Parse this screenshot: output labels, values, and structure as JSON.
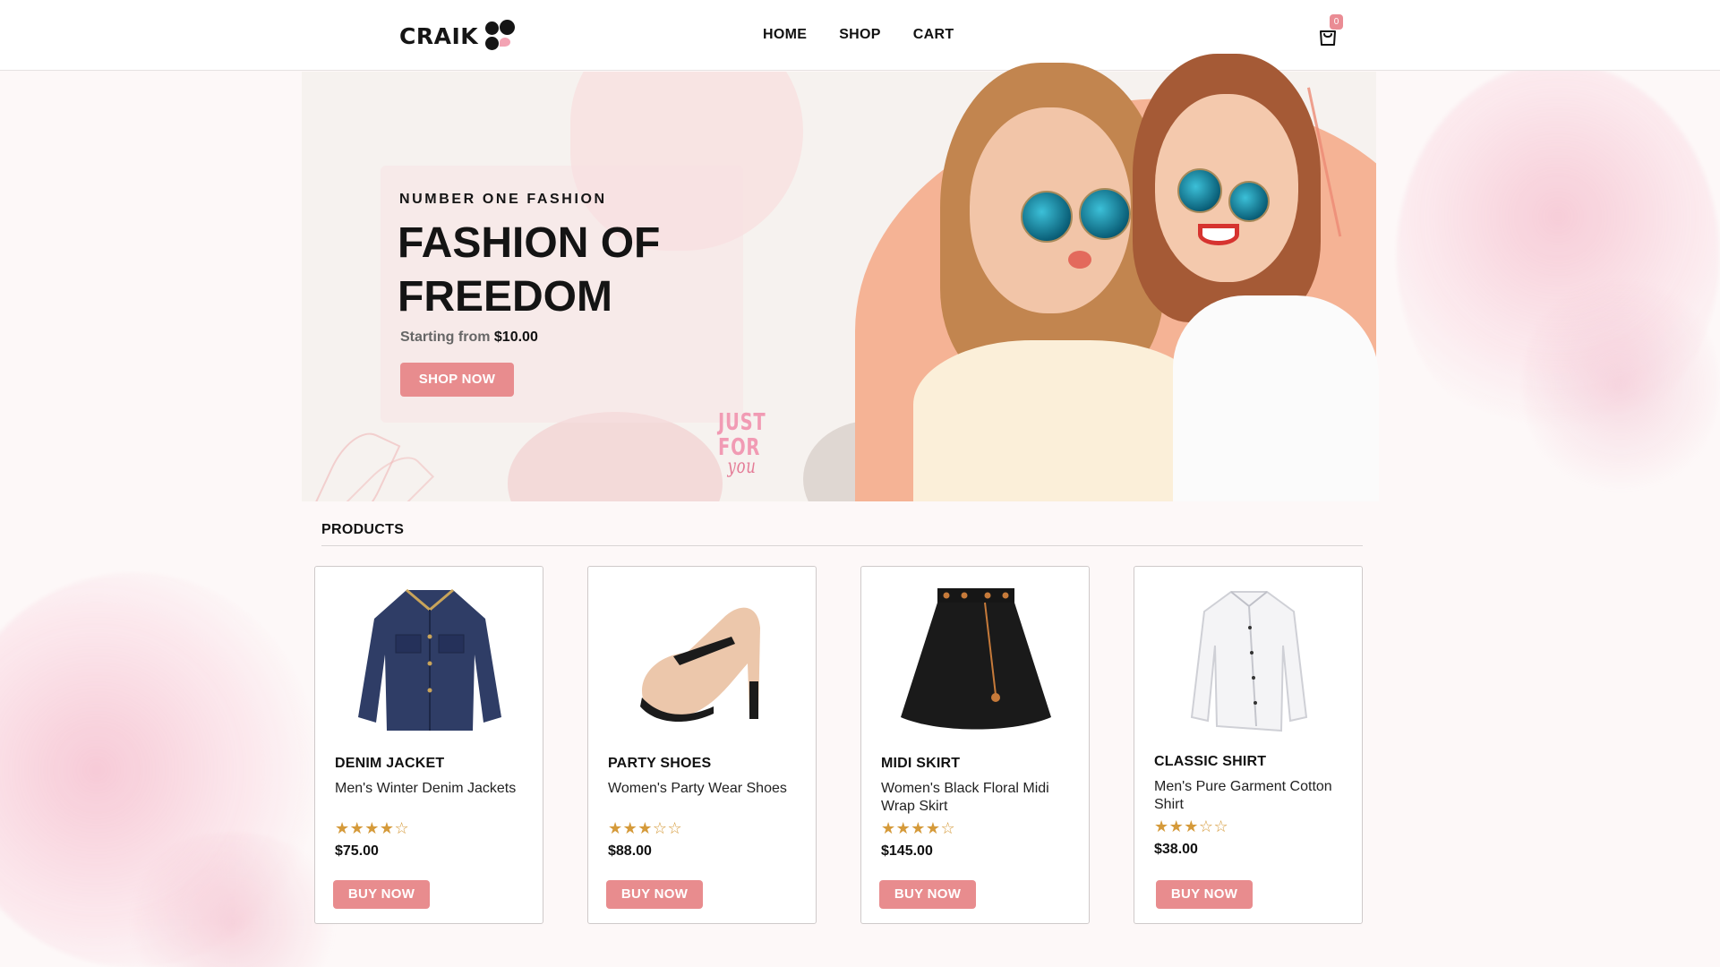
{
  "brand": {
    "name": "CRAIK"
  },
  "nav": {
    "items": [
      "HOME",
      "SHOP",
      "CART"
    ]
  },
  "cart": {
    "count": "0"
  },
  "hero": {
    "kicker": "NUMBER ONE FASHION",
    "title": "FASHION OF FREEDOM",
    "price_prefix": "Starting from",
    "price": "$10.00",
    "cta": "SHOP NOW",
    "badge_line1": "JUST",
    "badge_line2": "FOR",
    "badge_line3": "you"
  },
  "products_section": {
    "title": "PRODUCTS"
  },
  "products": [
    {
      "name": "DENIM JACKET",
      "description": "Men's Winter Denim Jackets",
      "rating": 4,
      "rating_stars": "★★★★☆",
      "price": "$75.00",
      "cta": "BUY NOW",
      "icon": "denim-jacket-image"
    },
    {
      "name": "PARTY SHOES",
      "description": "Women's Party Wear Shoes",
      "rating": 3,
      "rating_stars": "★★★☆☆",
      "price": "$88.00",
      "cta": "BUY NOW",
      "icon": "heel-shoe-image"
    },
    {
      "name": "MIDI SKIRT",
      "description": "Women's Black Floral Midi Wrap Skirt",
      "rating": 4,
      "rating_stars": "★★★★☆",
      "price": "$145.00",
      "cta": "BUY NOW",
      "icon": "black-skirt-image"
    },
    {
      "name": "CLASSIC SHIRT",
      "description": "Men's Pure Garment Cotton Shirt",
      "rating": 3,
      "rating_stars": "★★★☆☆",
      "price": "$38.00",
      "cta": "BUY NOW",
      "icon": "white-shirt-image"
    }
  ],
  "colors": {
    "accent": "#e88c8e",
    "star": "#d59a3a",
    "hero_peach": "#f5b395"
  }
}
